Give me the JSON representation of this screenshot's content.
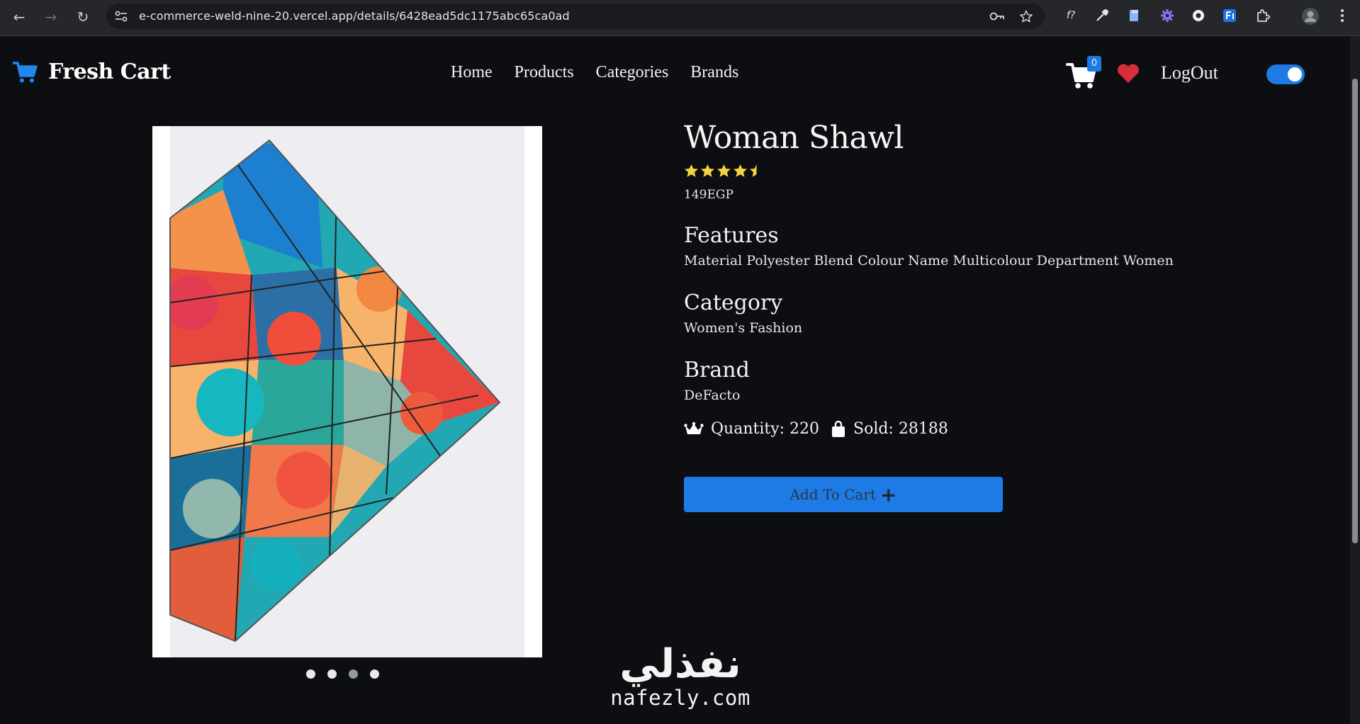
{
  "browser": {
    "url": "e-commerce-weld-nine-20.vercel.app/details/6428ead5dc1175abc65ca0ad",
    "back_icon": "←",
    "forward_icon": "→",
    "reload_icon": "↻",
    "ext_fx_label": "f?"
  },
  "navbar": {
    "brand": "Fresh Cart",
    "links": [
      "Home",
      "Products",
      "Categories",
      "Brands"
    ],
    "cart_count": "0",
    "logout": "LogOut",
    "accent_color": "#1e7be6",
    "heart_color": "#d92d3b"
  },
  "product": {
    "title": "Woman Shawl",
    "rating": 4.5,
    "price": "149EGP",
    "features_heading": "Features",
    "features": "Material Polyester Blend Colour Name Multicolour Department Women",
    "category_heading": "Category",
    "category": "Women's Fashion",
    "brand_heading": "Brand",
    "brand": "DeFacto",
    "quantity": "Quantity: 220",
    "sold": "Sold: 28188",
    "add_to_cart": "Add To Cart",
    "plus_icon": "+",
    "image_count": 4,
    "active_image": 3
  },
  "watermark": {
    "arabic": "نفذلي",
    "latin": "nafezly.com"
  }
}
